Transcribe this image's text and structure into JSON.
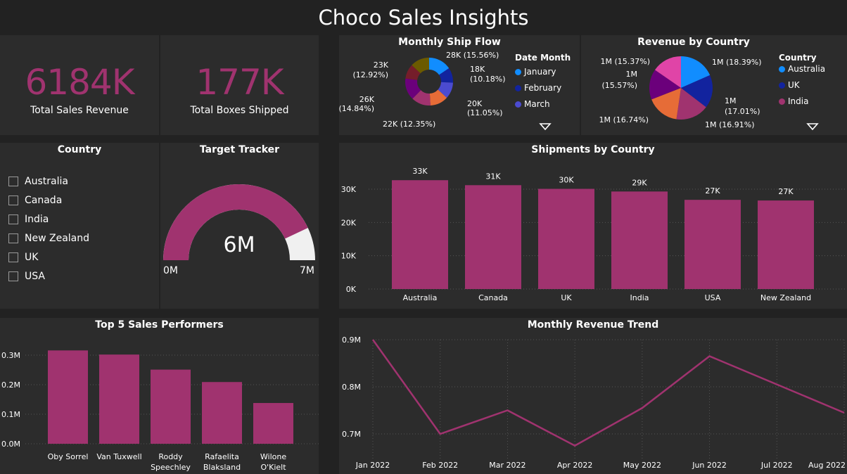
{
  "dashboard": {
    "title": "Choco Sales Insights"
  },
  "kpis": {
    "revenue": {
      "value": "6184K",
      "label": "Total Sales Revenue"
    },
    "boxes": {
      "value": "177K",
      "label": "Total Boxes Shipped"
    }
  },
  "slicer": {
    "title": "Country",
    "options": [
      "Australia",
      "Canada",
      "India",
      "New Zealand",
      "UK",
      "USA"
    ]
  },
  "gauge": {
    "title": "Target Tracker",
    "value_label": "6M",
    "min_label": "0M",
    "max_label": "7M",
    "fill_fraction": 0.86,
    "fill_color": "#a0336f",
    "track_color": "#f0f0f0"
  },
  "monthly_ship_flow": {
    "title": "Monthly Ship Flow",
    "legend_title": "Date Month",
    "legend": [
      {
        "label": "January",
        "color": "#118dff"
      },
      {
        "label": "February",
        "color": "#12239e"
      },
      {
        "label": "March",
        "color": "#4b4bd0"
      }
    ],
    "slices": [
      {
        "label": "28K (15.56%)",
        "percent": 15.56,
        "color": "#118dff"
      },
      {
        "label": "18K (10.18%)",
        "percent": 10.18,
        "color": "#12239e"
      },
      {
        "label": "20K (11.05%)",
        "percent": 11.05,
        "color": "#4b4bd0"
      },
      {
        "label": "22K (12.35%)",
        "percent": 12.35,
        "color": "#e66c37"
      },
      {
        "label": "",
        "percent": 13.1,
        "color": "#a0336f"
      },
      {
        "label": "26K (14.84%)",
        "percent": 14.84,
        "color": "#6b007b"
      },
      {
        "label": "",
        "percent": 10.0,
        "color": "#751d2a"
      },
      {
        "label": "23K (12.92%)",
        "percent": 12.92,
        "color": "#6b5a00"
      }
    ]
  },
  "revenue_by_country": {
    "title": "Revenue by Country",
    "legend_title": "Country",
    "legend": [
      {
        "label": "Australia",
        "color": "#118dff"
      },
      {
        "label": "UK",
        "color": "#12239e"
      },
      {
        "label": "India",
        "color": "#a0336f"
      }
    ],
    "slices": [
      {
        "label": "1M (18.39%)",
        "percent": 18.39,
        "color": "#118dff"
      },
      {
        "label": "1M (17.01%)",
        "percent": 17.01,
        "color": "#12239e"
      },
      {
        "label": "1M (16.91%)",
        "percent": 16.91,
        "color": "#a0336f"
      },
      {
        "label": "1M (16.74%)",
        "percent": 16.74,
        "color": "#e66c37"
      },
      {
        "label": "1M (15.57%)",
        "percent": 15.57,
        "color": "#6b007b"
      },
      {
        "label": "1M (15.37%)",
        "percent": 15.37,
        "color": "#e044a7"
      }
    ]
  },
  "chart_data": [
    {
      "type": "bar",
      "title": "Shipments by Country",
      "categories": [
        "Australia",
        "Canada",
        "UK",
        "India",
        "USA",
        "New Zealand"
      ],
      "values": [
        32700,
        31200,
        30100,
        29300,
        26800,
        26600
      ],
      "data_labels": [
        "33K",
        "31K",
        "30K",
        "29K",
        "27K",
        "27K"
      ],
      "yticks": [
        "0K",
        "10K",
        "20K",
        "30K"
      ],
      "ylim": [
        0,
        30000
      ],
      "color": "#a0336f",
      "grid": true
    },
    {
      "type": "bar",
      "title": "Top 5 Sales Performers",
      "categories": [
        "Oby Sorrel",
        "Van Tuxwell",
        "Roddy Speechley",
        "Rafaelita Blaksland",
        "Wilone O'Kielt"
      ],
      "category_lines": [
        [
          "Oby Sorrel"
        ],
        [
          "Van Tuxwell"
        ],
        [
          "Roddy",
          "Speechley"
        ],
        [
          "Rafaelita",
          "Blaksland"
        ],
        [
          "Wilone",
          "O'Kielt"
        ]
      ],
      "values": [
        0.316,
        0.302,
        0.251,
        0.209,
        0.138
      ],
      "yticks": [
        "0.0M",
        "0.1M",
        "0.2M",
        "0.3M"
      ],
      "ylim": [
        0,
        0.3
      ],
      "color": "#a0336f",
      "grid": true
    },
    {
      "type": "line",
      "title": "Monthly Revenue Trend",
      "x": [
        "Jan 2022",
        "Feb 2022",
        "Mar 2022",
        "Apr 2022",
        "May 2022",
        "Jun 2022",
        "Jul 2022",
        "Aug 2022"
      ],
      "values": [
        0.9,
        0.7,
        0.75,
        0.675,
        0.755,
        0.865,
        0.805,
        0.745
      ],
      "yticks": [
        "0.7M",
        "0.8M",
        "0.9M"
      ],
      "ylim": [
        0.7,
        0.9
      ],
      "color": "#a0336f",
      "grid": true
    }
  ]
}
